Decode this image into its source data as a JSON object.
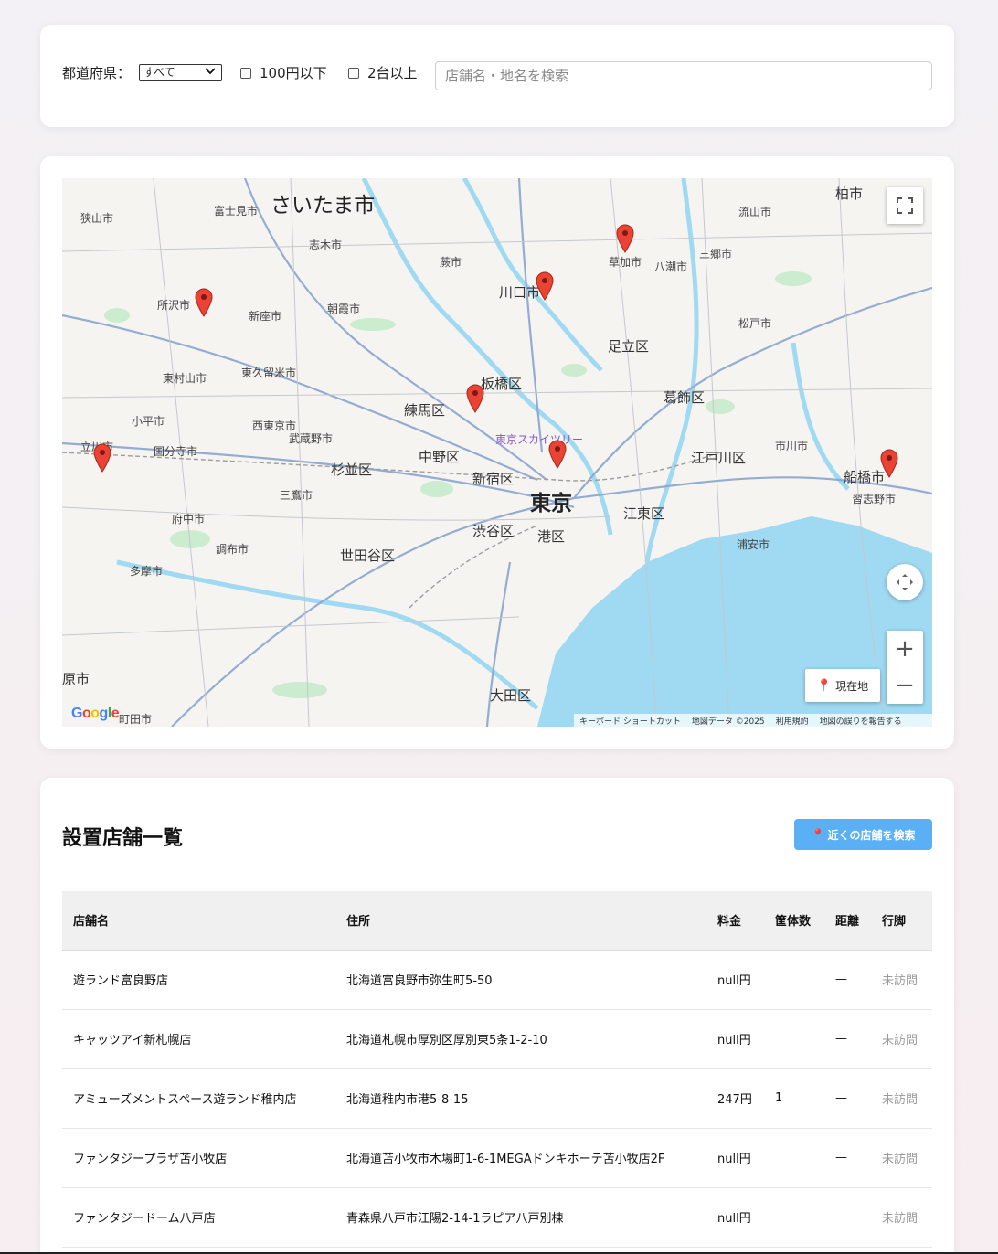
{
  "filters": {
    "prefecture_label": "都道府県：",
    "prefecture_value": "すべて",
    "check_price_label": "100円以下",
    "check_units_label": "2台以上",
    "search_placeholder": "店舗名・地名を検索"
  },
  "map": {
    "labels": {
      "saitama": "さいたま市",
      "tokyo": "東京",
      "kawaguchi": "川口市",
      "adachi": "足立区",
      "itabashi": "板橋区",
      "nerima": "練馬区",
      "katsushika": "葛飾区",
      "nakano": "中野区",
      "suginami": "杉並区",
      "shinjuku": "新宿区",
      "shibuya": "渋谷区",
      "minato": "港区",
      "koto": "江東区",
      "edogawa": "江戸川区",
      "setagaya": "世田谷区",
      "ota": "大田区",
      "funabashi": "船橋市",
      "kashiwa": "柏市",
      "tokorozawa": "所沢市",
      "soka": "草加市",
      "skytree": "東京スカイツリー",
      "fujimi": "富士見市",
      "shiki": "志木市",
      "asaka": "朝霞市",
      "niiza": "新座市",
      "higashikurume": "東久留米市",
      "nishitokyo": "西東京市",
      "kodaira": "小平市",
      "kokubunji": "国分寺市",
      "tachikawa": "立川市",
      "fuchu": "府中市",
      "chofu": "調布市",
      "mitaka": "三鷹市",
      "tama": "多摩市",
      "musashino": "武蔵野市",
      "matsudo": "松戸市",
      "misato": "三郷市",
      "yashio": "八潮市",
      "ichikawa": "市川市",
      "urayasu": "浦安市",
      "narashino": "習志野市",
      "nagareyama": "流山市",
      "warabi": "蕨市",
      "sayama": "狭山市",
      "higashimurayama": "東村山市",
      "machida": "町田市",
      "hara": "原市"
    },
    "controls": {
      "locate_label": "現在地",
      "zoom_in": "+",
      "zoom_out": "−"
    },
    "footer": {
      "shortcuts": "キーボード ショートカット",
      "map_data": "地図データ ©2025",
      "terms": "利用規約",
      "report": "地図の誤りを報告する"
    },
    "logo": "Google"
  },
  "list": {
    "title": "設置店舗一覧",
    "near_button": "近くの店舗を検索",
    "columns": {
      "name": "店舗名",
      "address": "住所",
      "price": "料金",
      "units": "筐体数",
      "distance": "距離",
      "status": "行脚"
    },
    "rows": [
      {
        "name": "遊ランド富良野店",
        "address": "北海道富良野市弥生町5-50",
        "price": "null円",
        "units": "",
        "distance": "—",
        "status": "未訪問"
      },
      {
        "name": "キャッツアイ新札幌店",
        "address": "北海道札幌市厚別区厚別東5条1-2-10",
        "price": "null円",
        "units": "",
        "distance": "—",
        "status": "未訪問"
      },
      {
        "name": "アミューズメントスペース遊ランド稚内店",
        "address": "北海道稚内市港5-8-15",
        "price": "247円",
        "units": "1",
        "distance": "—",
        "status": "未訪問"
      },
      {
        "name": "ファンタジープラザ苫小牧店",
        "address": "北海道苫小牧市木場町1-6-1MEGAドンキホーテ苫小牧店2F",
        "price": "null円",
        "units": "",
        "distance": "—",
        "status": "未訪問"
      },
      {
        "name": "ファンタジードーム八戸店",
        "address": "青森県八戸市江陽2-14-1ラピア八戸別棟",
        "price": "null円",
        "units": "",
        "distance": "—",
        "status": "未訪問"
      }
    ]
  },
  "colors": {
    "accent": "#5bb0f5",
    "marker": "#ea4335",
    "water": "#9fd9f2",
    "park": "#bfe8c5"
  }
}
